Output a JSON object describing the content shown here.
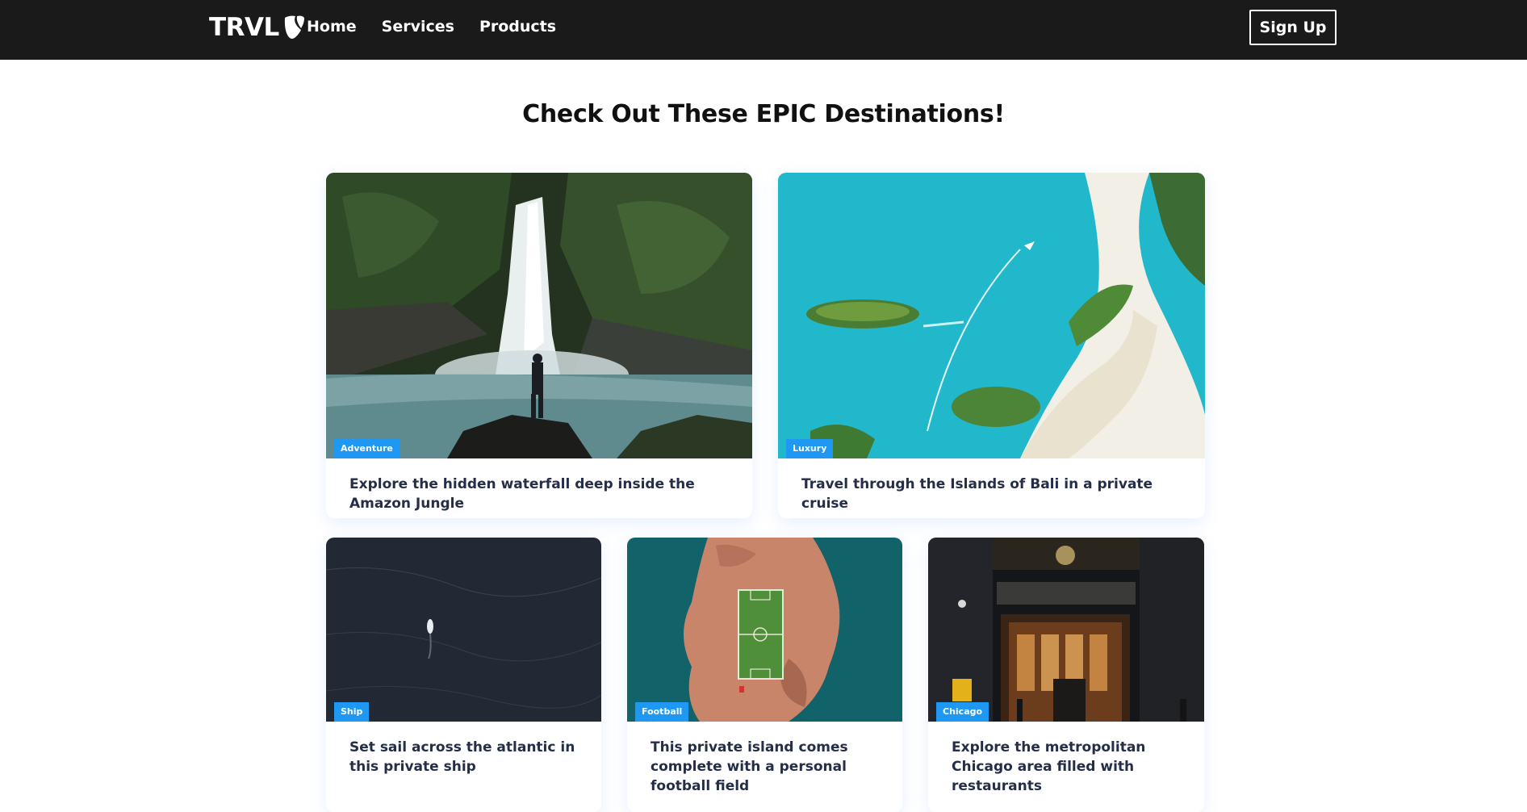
{
  "navbar": {
    "logo": "TRVL",
    "links": [
      "Home",
      "Services",
      "Products"
    ],
    "signup_label": "Sign Up"
  },
  "heading": "Check Out These EPIC Destinations!",
  "cards": [
    {
      "tag": "Adventure",
      "text": "Explore the hidden waterfall deep inside the Amazon Jungle"
    },
    {
      "tag": "Luxury",
      "text": "Travel through the Islands of Bali in a private cruise"
    },
    {
      "tag": "Ship",
      "text": "Set sail across the atlantic in this private ship"
    },
    {
      "tag": "Football",
      "text": "This private island comes complete with a personal football field"
    },
    {
      "tag": "Chicago",
      "text": "Explore the metropolitan Chicago area filled with restaurants"
    }
  ],
  "colors": {
    "navbar_bg": "#1b1a1a",
    "badge": "#1f98f4",
    "card_text": "#252e48"
  }
}
